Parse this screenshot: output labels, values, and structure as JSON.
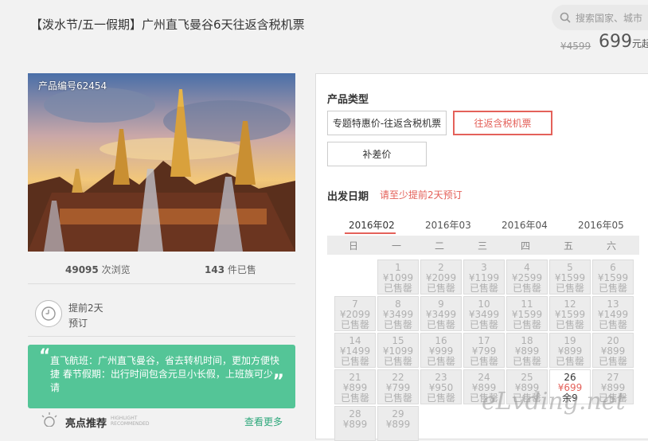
{
  "header": {
    "title": "【泼水节/五一假期】广州直飞曼谷6天往返含税机票",
    "search_placeholder": "搜索国家、城市",
    "old_price": "¥4599",
    "price": "699",
    "price_unit": "元起"
  },
  "product": {
    "code": "产品编号62454",
    "views_count": "49095",
    "views_label": "次浏览",
    "sold_count": "143",
    "sold_label": "件已售",
    "advance_line1": "提前2天",
    "advance_line2": "预订"
  },
  "highlights": {
    "text": "直飞航班：广州直飞曼谷，省去转机时间，更加方便快捷 春节假期：出行时间包含元旦小长假，上班族可少请",
    "title": "亮点推荐",
    "title_en_1": "HIGHLIGHT",
    "title_en_2": "RECOMMENDED",
    "more": "查看更多"
  },
  "booking": {
    "type_label": "产品类型",
    "options": [
      "专题特惠价-往返含税机票",
      "往返含税机票",
      "补差价"
    ],
    "selected_option": 1,
    "date_label": "出发日期",
    "date_note": "请至少提前2天预订",
    "months": [
      "2016年02",
      "2016年03",
      "2016年04",
      "2016年05"
    ],
    "active_month": 0,
    "weekdays": [
      "日",
      "一",
      "二",
      "三",
      "四",
      "五",
      "六"
    ]
  },
  "calendar": [
    {
      "day": "1",
      "price": "¥1099",
      "status": "已售罄",
      "col": 1,
      "row": 0
    },
    {
      "day": "2",
      "price": "¥2099",
      "status": "已售罄",
      "col": 2,
      "row": 0
    },
    {
      "day": "3",
      "price": "¥1199",
      "status": "已售罄",
      "col": 3,
      "row": 0
    },
    {
      "day": "4",
      "price": "¥2599",
      "status": "已售罄",
      "col": 4,
      "row": 0
    },
    {
      "day": "5",
      "price": "¥1599",
      "status": "已售罄",
      "col": 5,
      "row": 0
    },
    {
      "day": "6",
      "price": "¥1599",
      "status": "已售罄",
      "col": 6,
      "row": 0
    },
    {
      "day": "7",
      "price": "¥2099",
      "status": "已售罄",
      "col": 0,
      "row": 1
    },
    {
      "day": "8",
      "price": "¥3499",
      "status": "已售罄",
      "col": 1,
      "row": 1
    },
    {
      "day": "9",
      "price": "¥3499",
      "status": "已售罄",
      "col": 2,
      "row": 1
    },
    {
      "day": "10",
      "price": "¥3499",
      "status": "已售罄",
      "col": 3,
      "row": 1
    },
    {
      "day": "11",
      "price": "¥1599",
      "status": "已售罄",
      "col": 4,
      "row": 1
    },
    {
      "day": "12",
      "price": "¥1599",
      "status": "已售罄",
      "col": 5,
      "row": 1
    },
    {
      "day": "13",
      "price": "¥1499",
      "status": "已售罄",
      "col": 6,
      "row": 1
    },
    {
      "day": "14",
      "price": "¥1499",
      "status": "已售罄",
      "col": 0,
      "row": 2
    },
    {
      "day": "15",
      "price": "¥1099",
      "status": "已售罄",
      "col": 1,
      "row": 2
    },
    {
      "day": "16",
      "price": "¥999",
      "status": "已售罄",
      "col": 2,
      "row": 2
    },
    {
      "day": "17",
      "price": "¥799",
      "status": "已售罄",
      "col": 3,
      "row": 2
    },
    {
      "day": "18",
      "price": "¥899",
      "status": "已售罄",
      "col": 4,
      "row": 2
    },
    {
      "day": "19",
      "price": "¥899",
      "status": "已售罄",
      "col": 5,
      "row": 2
    },
    {
      "day": "20",
      "price": "¥899",
      "status": "已售罄",
      "col": 6,
      "row": 2
    },
    {
      "day": "21",
      "price": "¥899",
      "status": "已售罄",
      "col": 0,
      "row": 3
    },
    {
      "day": "22",
      "price": "¥799",
      "status": "已售罄",
      "col": 1,
      "row": 3
    },
    {
      "day": "23",
      "price": "¥950",
      "status": "已售罄",
      "col": 2,
      "row": 3
    },
    {
      "day": "24",
      "price": "¥899",
      "status": "已售罄",
      "col": 3,
      "row": 3
    },
    {
      "day": "25",
      "price": "¥899",
      "status": "已售罄",
      "col": 4,
      "row": 3
    },
    {
      "day": "26",
      "price": "¥699",
      "status": "余9",
      "col": 5,
      "row": 3,
      "available": true
    },
    {
      "day": "27",
      "price": "¥899",
      "status": "已售罄",
      "col": 6,
      "row": 3
    },
    {
      "day": "28",
      "price": "¥899",
      "status": "",
      "col": 0,
      "row": 4
    },
    {
      "day": "29",
      "price": "¥899",
      "status": "",
      "col": 1,
      "row": 4
    }
  ],
  "watermark": "eLvding.net",
  "colors": {
    "accent": "#e4615a",
    "green": "#54c597",
    "link": "#2fa87c"
  }
}
